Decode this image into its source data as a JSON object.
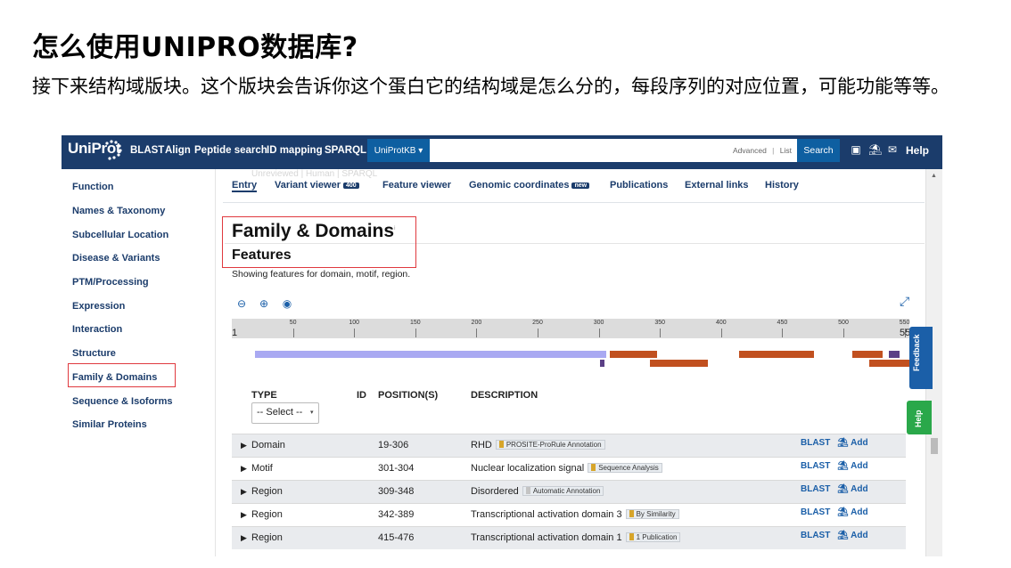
{
  "slide": {
    "title": "怎么使用UNIPRO数据库?",
    "body": "接下来结构域版块。这个版块会告诉你这个蛋白它的结构域是怎么分的，每段序列的对应位置，可能功能等等。"
  },
  "uniprot": {
    "logo": "UniProt",
    "nav": {
      "blast": "BLAST",
      "align": "Align",
      "peptide": "Peptide search",
      "idmapping": "ID mapping",
      "sparql": "SPARQL"
    },
    "db_select": "UniProtKB ▾",
    "search": {
      "placeholder": "",
      "advanced": "Advanced",
      "separator": "|",
      "list": "List",
      "button": "Search"
    },
    "help": "Help"
  },
  "sidebar": {
    "items": [
      "Function",
      "Names & Taxonomy",
      "Subcellular Location",
      "Disease & Variants",
      "PTM/Processing",
      "Expression",
      "Interaction",
      "Structure",
      "Family & Domains",
      "Sequence & Isoforms",
      "Similar Proteins"
    ]
  },
  "tabs": {
    "entry": "Entry",
    "variant_viewer": "Variant viewer",
    "variant_badge": "400",
    "feature_viewer": "Feature viewer",
    "genomic": "Genomic coordinates",
    "genomic_badge": "new",
    "publications": "Publications",
    "external": "External links",
    "history": "History"
  },
  "ghost_text": "Unreviewed | Human | SPARQL",
  "section": {
    "title": "Family & Domains",
    "subtitle": "Features",
    "desc": "Showing features for domain, motif, region."
  },
  "track": {
    "start": "1",
    "end": "55",
    "tick_labels": [
      "50",
      "100",
      "150",
      "200",
      "250",
      "300",
      "350",
      "400",
      "450",
      "500",
      "550"
    ],
    "domain_color": "#a9a9f2",
    "region_color": "#c1501f",
    "motif_color": "#5b3f86",
    "features": [
      {
        "kind": "domain",
        "start": 19,
        "end": 306,
        "lane": 0
      },
      {
        "kind": "region",
        "start": 309,
        "end": 348,
        "lane": 0
      },
      {
        "kind": "motif",
        "start": 301,
        "end": 304,
        "lane": 1
      },
      {
        "kind": "region",
        "start": 342,
        "end": 389,
        "lane": 1
      },
      {
        "kind": "region",
        "start": 415,
        "end": 476,
        "lane": 0
      },
      {
        "kind": "region",
        "start": 507,
        "end": 532,
        "lane": 0
      },
      {
        "kind": "motif",
        "start": 537,
        "end": 546,
        "lane": 0
      },
      {
        "kind": "region",
        "start": 521,
        "end": 560,
        "lane": 1
      }
    ]
  },
  "table": {
    "headers": {
      "type": "TYPE",
      "id": "ID",
      "position": "POSITION(S)",
      "description": "DESCRIPTION"
    },
    "type_select": "-- Select --",
    "rows": [
      {
        "type": "Domain",
        "position": "19-306",
        "description": "RHD",
        "evidence": "PROSITE-ProRule Annotation",
        "flag": "gold",
        "blast": "BLAST",
        "add": "Add"
      },
      {
        "type": "Motif",
        "position": "301-304",
        "description": "Nuclear localization signal",
        "evidence": "Sequence Analysis",
        "flag": "gold",
        "blast": "BLAST",
        "add": "Add"
      },
      {
        "type": "Region",
        "position": "309-348",
        "description": "Disordered",
        "evidence": "Automatic Annotation",
        "flag": "grey",
        "blast": "BLAST",
        "add": "Add"
      },
      {
        "type": "Region",
        "position": "342-389",
        "description": "Transcriptional activation domain 3",
        "evidence": "By Similarity",
        "flag": "gold",
        "blast": "BLAST",
        "add": "Add"
      },
      {
        "type": "Region",
        "position": "415-476",
        "description": "Transcriptional activation domain 1",
        "evidence": "1 Publication",
        "flag": "gold",
        "blast": "BLAST",
        "add": "Add"
      }
    ]
  },
  "floating": {
    "feedback": "Feedback",
    "help": "Help"
  }
}
